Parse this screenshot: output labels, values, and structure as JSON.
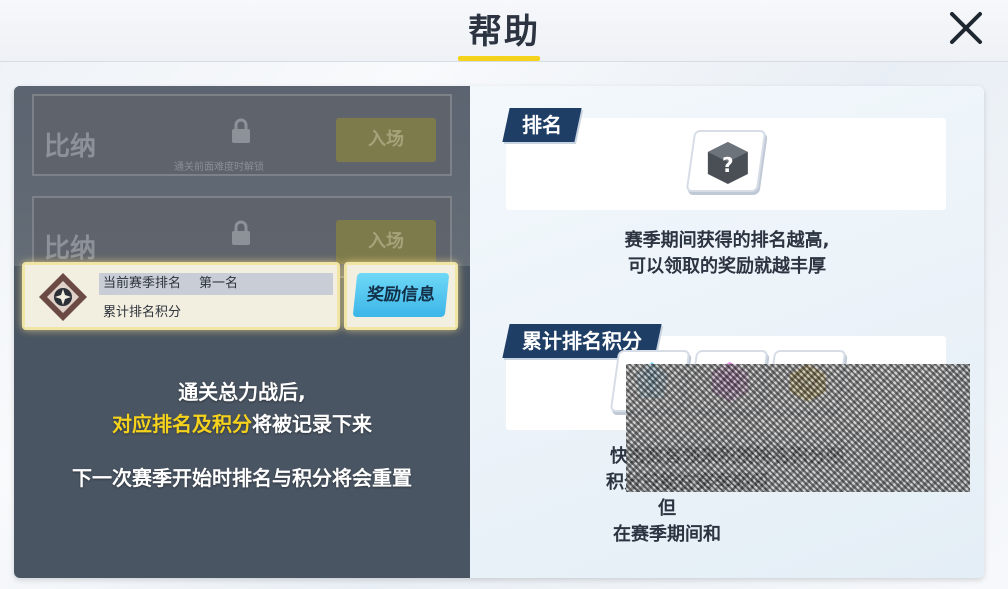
{
  "header": {
    "title": "帮助"
  },
  "left": {
    "stages": [
      {
        "name": "比纳",
        "hint": "通关前面难度时解锁",
        "enter": "入场"
      },
      {
        "name": "比纳",
        "hint": "",
        "enter": "入场"
      }
    ],
    "rank_label": "当前赛季排名",
    "rank_value": "第一名",
    "points_label": "累计排名积分",
    "reward_button": "奖励信息",
    "desc_line1": "通关总力战后,",
    "desc_line2_highlight": "对应排名及积分",
    "desc_line2_rest": "将被记录下来",
    "desc_line3": "下一次赛季开始时排名与积分将会重置"
  },
  "right": {
    "ranking_tag": "排名",
    "ranking_icon": "mystery-cube-icon",
    "ranking_text1": "赛季期间获得的排名越高,",
    "ranking_text2": "可以领取的奖励就越丰厚",
    "points_tag": "累计排名积分",
    "points_icons": [
      "blue-crystal-icon",
      "pink-crystal-icon",
      "gold-chest-icon"
    ],
    "points_text1": "快击败首领来积攒排名积分吧",
    "points_text2": "积分只能在赛季期间",
    "points_text3": "但",
    "points_text4": "在赛季期间和"
  },
  "colors": {
    "accent_yellow": "#f5d21c",
    "tag_navy": "#1f3e66",
    "button_cyan": "#3bb6e8"
  }
}
